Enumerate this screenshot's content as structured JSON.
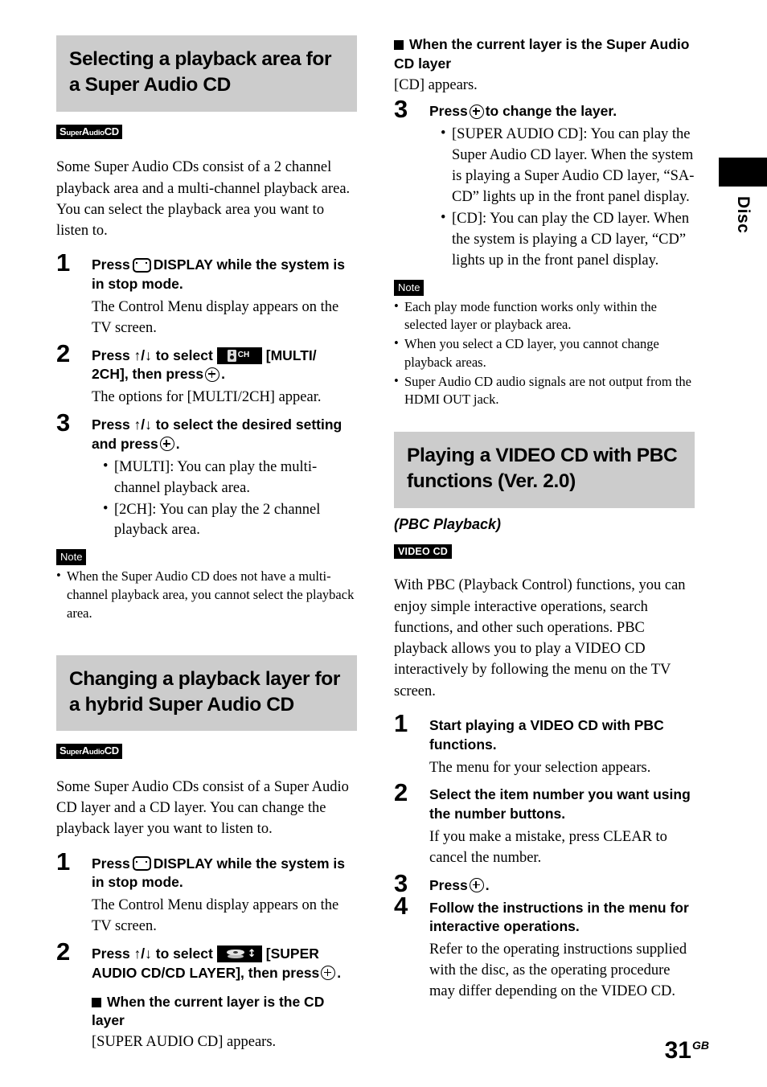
{
  "page": {
    "number": "31",
    "number_suffix": "GB",
    "side_tab_label": "Disc"
  },
  "icons": {
    "display": "display-icon",
    "enter": "enter-icon",
    "multi_2ch_box": "multi-2ch-control-icon",
    "layer_box": "super-audio-cd-layer-control-icon",
    "arrows_updown": "↑/↓"
  },
  "badges": {
    "super_audio_cd": {
      "s": "S",
      "uper": "uper",
      "a": "A",
      "udio": "udio",
      "cd": "CD"
    },
    "video_cd": "VIDEO CD",
    "note": "Note"
  },
  "left_column": {
    "section1": {
      "heading": "Selecting a playback area for a Super Audio CD",
      "intro": "Some Super Audio CDs consist of a 2 channel playback area and a multi-channel playback area. You can select the playback area you want to listen to.",
      "steps": [
        {
          "num": "1",
          "title_pre": "Press",
          "title_post": "DISPLAY while the system is in stop mode.",
          "desc": "The Control Menu display appears on the TV screen."
        },
        {
          "num": "2",
          "title_pre": "Press ↑/↓ to select",
          "title_mid": "[MULTI/ 2CH], then press",
          "title_post": ".",
          "desc": "The options for [MULTI/2CH] appear."
        },
        {
          "num": "3",
          "title_pre": "Press ↑/↓ to select the desired setting and press",
          "title_post": ".",
          "bullets": [
            "[MULTI]: You can play the multi-channel playback area.",
            "[2CH]: You can play the 2 channel playback area."
          ]
        }
      ],
      "notes": [
        "When the Super Audio CD does not have a multi-channel playback area, you cannot select the playback area."
      ]
    },
    "section2": {
      "heading": "Changing a playback layer for a hybrid Super Audio CD",
      "intro": "Some Super Audio CDs consist of a Super Audio CD layer and a CD layer. You can change the playback layer you want to listen to.",
      "steps": [
        {
          "num": "1",
          "title_pre": "Press",
          "title_post": "DISPLAY while the system is in stop mode.",
          "desc": "The Control Menu display appears on the TV screen."
        },
        {
          "num": "2",
          "title_pre": "Press ↑/↓ to select",
          "title_mid": "[SUPER AUDIO CD/CD LAYER], then press",
          "title_post": ".",
          "sub_heading": "When the current layer is the CD layer",
          "sub_desc": "[SUPER AUDIO CD] appears."
        }
      ]
    }
  },
  "right_column": {
    "continued": {
      "sub_heading": "When the current layer is the Super Audio CD layer",
      "sub_desc": "[CD] appears.",
      "step3": {
        "num": "3",
        "title_pre": "Press",
        "title_post": "to change the layer.",
        "bullets": [
          "[SUPER AUDIO CD]: You can play the Super Audio CD layer. When the system is playing a Super Audio CD layer, “SA-CD” lights up in the front panel display.",
          "[CD]: You can play the CD layer. When the system is playing a CD layer, “CD” lights up in the front panel display."
        ]
      },
      "notes": [
        "Each play mode function works only within the selected layer or playback area.",
        "When you select a CD layer, you cannot change playback areas.",
        "Super Audio CD audio signals are not output from the HDMI OUT jack."
      ]
    },
    "section3": {
      "heading": "Playing a VIDEO CD with PBC functions (Ver. 2.0)",
      "subtitle": "(PBC Playback)",
      "intro": "With PBC (Playback Control) functions, you can enjoy simple interactive operations, search functions, and other such operations. PBC playback allows you to play a VIDEO CD interactively by following the menu on the TV screen.",
      "steps": [
        {
          "num": "1",
          "title": "Start playing a VIDEO CD with PBC functions.",
          "desc": "The menu for your selection appears."
        },
        {
          "num": "2",
          "title": "Select the item number you want using the number buttons.",
          "desc": "If you make a mistake, press CLEAR to cancel the number."
        },
        {
          "num": "3",
          "title_pre": "Press",
          "title_post": "."
        },
        {
          "num": "4",
          "title": "Follow the instructions in the menu for interactive operations.",
          "desc": "Refer to the operating instructions supplied with the disc, as the operating procedure may differ depending on the VIDEO CD."
        }
      ]
    }
  }
}
